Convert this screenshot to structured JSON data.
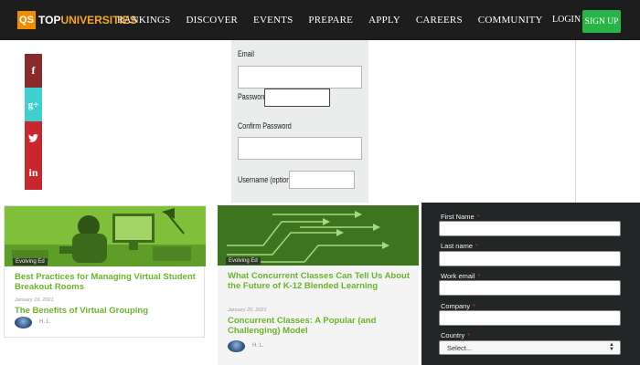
{
  "nav": {
    "logo_badge": "QS",
    "logo_top": "TOP",
    "logo_uni": "UNIVERSITIES",
    "links": [
      "RANKINGS",
      "DISCOVER",
      "EVENTS",
      "PREPARE",
      "APPLY",
      "CAREERS",
      "COMMUNITY"
    ],
    "login": "LOGIN",
    "signup": "SIGN UP"
  },
  "social": {
    "facebook": "f",
    "googleplus": "g+",
    "twitter": "t",
    "linkedin": "in"
  },
  "register": {
    "email_label": "Email",
    "password_label": "Password",
    "confirm_label": "Confirm Password",
    "username_label": "Username (optional)"
  },
  "cards": [
    {
      "tag": "Evolving Ed",
      "title": "Best Practices for Managing Virtual Student Breakout Rooms",
      "date": "January 19, 2021",
      "subtitle": "The Benefits of Virtual Grouping",
      "author": "H. L."
    },
    {
      "tag": "Evolving Ed",
      "title": "What Concurrent Classes Can Tell Us About the Future of K-12 Blended Learning",
      "date": "January 20, 2021",
      "subtitle": "Concurrent Classes: A Popular (and Challenging) Model",
      "author": "H. L."
    }
  ],
  "lead": {
    "first_name": "First Name",
    "last_name": "Last name",
    "work_email": "Work email",
    "company": "Company",
    "country": "Country",
    "required_mark": "*",
    "country_select": "Select..."
  },
  "colors": {
    "nav_bg": "#1d1d1d",
    "brand_orange": "#f08c00",
    "signup_green": "#28b446",
    "title_green": "#6ab528",
    "lead_bg": "#232626"
  }
}
